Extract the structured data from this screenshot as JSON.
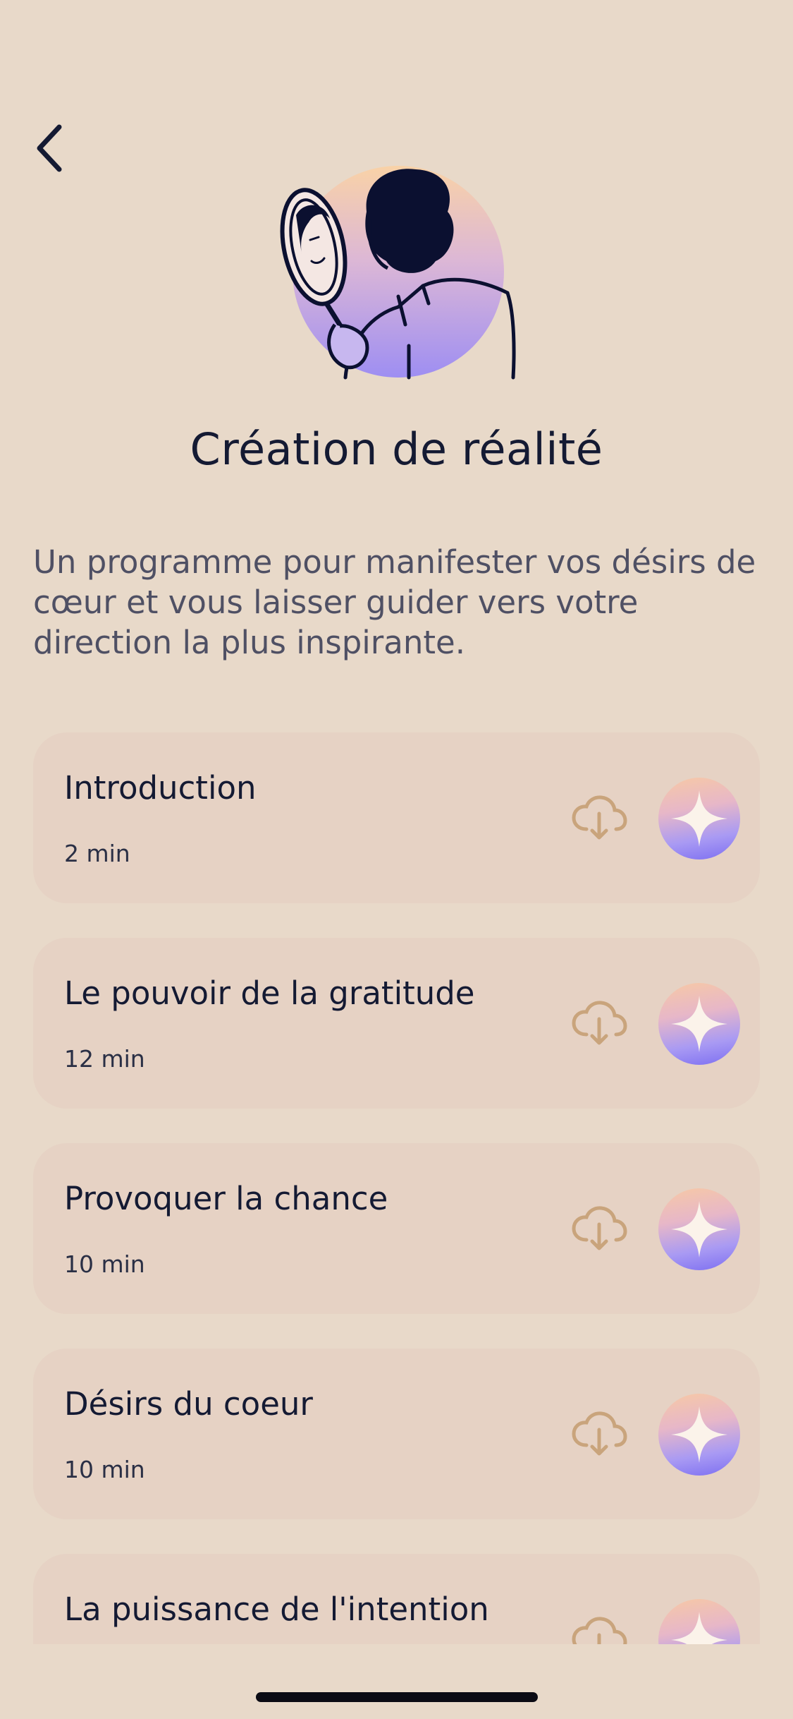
{
  "header": {
    "back_icon": "chevron-left-icon",
    "hero_icon": "woman-with-mirror-illustration"
  },
  "program": {
    "title": "Création de réalité",
    "description": "Un programme pour manifester vos désirs de cœur et vous laisser guider vers votre direction la plus inspirante."
  },
  "sessions": [
    {
      "title": "Introduction",
      "duration": "2 min"
    },
    {
      "title": "Le pouvoir de la gratitude",
      "duration": "12 min"
    },
    {
      "title": "Provoquer la chance",
      "duration": "10 min"
    },
    {
      "title": "Désirs du coeur",
      "duration": "10 min"
    },
    {
      "title": "La puissance de l'intention",
      "duration": ""
    }
  ],
  "icons": {
    "download": "cloud-download-icon",
    "play": "sparkle-play-icon"
  },
  "colors": {
    "background": "#e8d9c9",
    "card": "#e6d2c4",
    "text": "#141a33",
    "download_icon": "#c9a47c",
    "accent_gradient": [
      "#f7c9a5",
      "#a99af3",
      "#7c6ef2"
    ]
  }
}
